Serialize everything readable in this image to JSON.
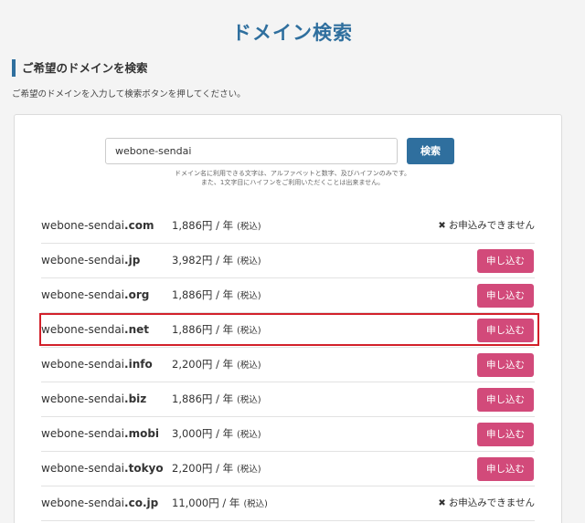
{
  "page": {
    "title": "ドメイン検索",
    "section_heading": "ご希望のドメインを検索",
    "section_desc": "ご希望のドメインを入力して検索ボタンを押してください。"
  },
  "search": {
    "value": "webone-sendai",
    "button_label": "検索",
    "note_line1": "ドメイン名に利用できる文字は、アルファベットと数字、及びハイフンのみです。",
    "note_line2": "また、1文字目にハイフンをご利用いただくことは出来ません。"
  },
  "results": [
    {
      "name": "webone-sendai",
      "tld": ".com",
      "price": "1,886円 / 年",
      "tax": "(税込)",
      "available": false,
      "status": "お申込みできません"
    },
    {
      "name": "webone-sendai",
      "tld": ".jp",
      "price": "3,982円 / 年",
      "tax": "(税込)",
      "available": true,
      "action": "申し込む"
    },
    {
      "name": "webone-sendai",
      "tld": ".org",
      "price": "1,886円 / 年",
      "tax": "(税込)",
      "available": true,
      "action": "申し込む"
    },
    {
      "name": "webone-sendai",
      "tld": ".net",
      "price": "1,886円 / 年",
      "tax": "(税込)",
      "available": true,
      "action": "申し込む"
    },
    {
      "name": "webone-sendai",
      "tld": ".info",
      "price": "2,200円 / 年",
      "tax": "(税込)",
      "available": true,
      "action": "申し込む"
    },
    {
      "name": "webone-sendai",
      "tld": ".biz",
      "price": "1,886円 / 年",
      "tax": "(税込)",
      "available": true,
      "action": "申し込む"
    },
    {
      "name": "webone-sendai",
      "tld": ".mobi",
      "price": "3,000円 / 年",
      "tax": "(税込)",
      "available": true,
      "action": "申し込む"
    },
    {
      "name": "webone-sendai",
      "tld": ".tokyo",
      "price": "2,200円 / 年",
      "tax": "(税込)",
      "available": true,
      "action": "申し込む"
    },
    {
      "name": "webone-sendai",
      "tld": ".co.jp",
      "price": "11,000円 / 年",
      "tax": "(税込)",
      "available": false,
      "status": "お申込みできません"
    }
  ],
  "colors": {
    "accent": "#2f6f9e",
    "apply_button": "#d24a7a",
    "highlight": "#d2202a"
  },
  "icons": {
    "unavailable": "close-icon"
  }
}
